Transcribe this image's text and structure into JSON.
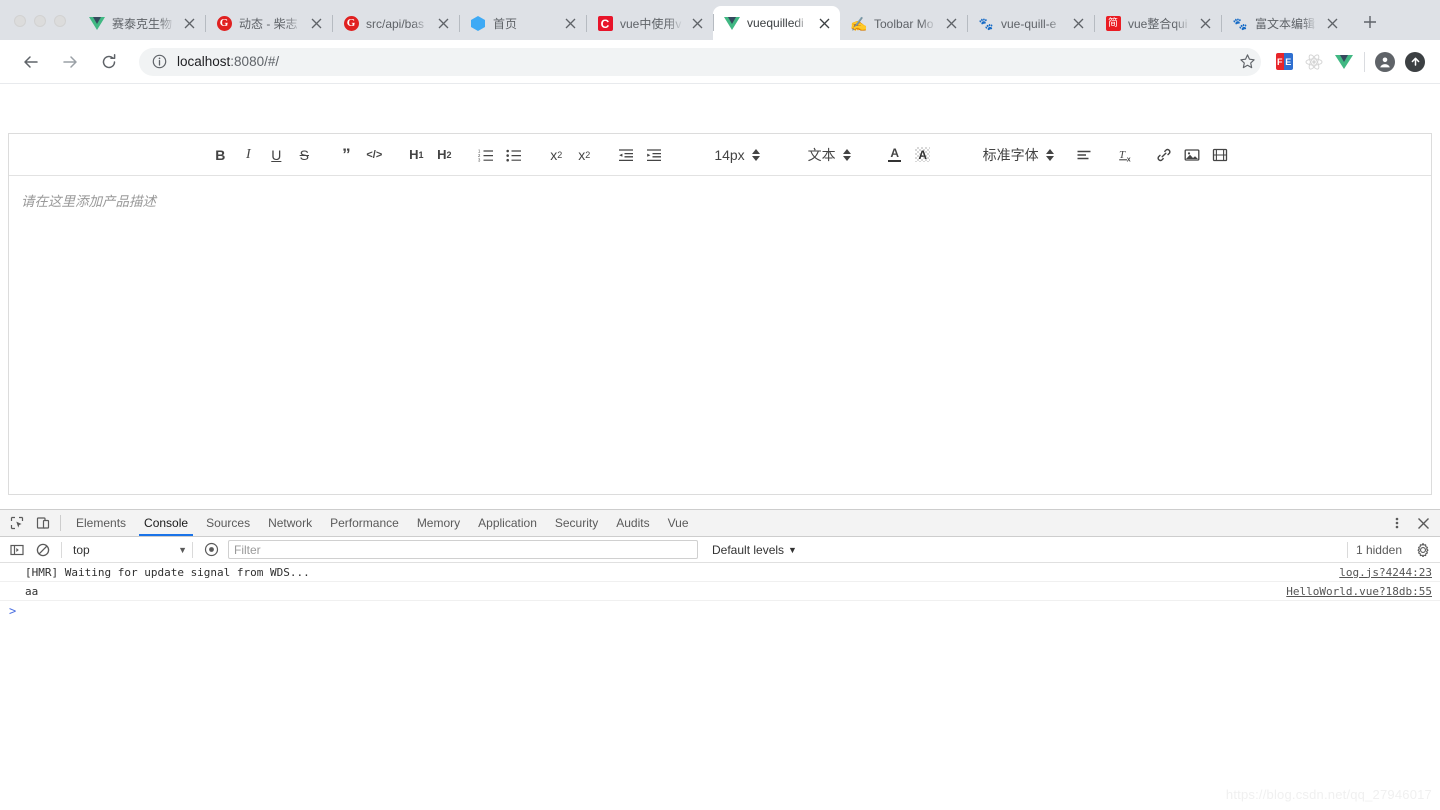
{
  "browser": {
    "window_controls": [
      "close",
      "minimize",
      "maximize"
    ],
    "tabs": [
      {
        "title": "赛泰克生物",
        "icon": "vue-icon",
        "active": false
      },
      {
        "title": "动态 - 柴志",
        "icon": "gitee-icon",
        "active": false
      },
      {
        "title": "src/api/bas",
        "icon": "gitee-icon",
        "active": false
      },
      {
        "title": "首页",
        "icon": "cube-icon",
        "active": false
      },
      {
        "title": "vue中使用v",
        "icon": "csdn-icon",
        "active": false
      },
      {
        "title": "vuequilledi",
        "icon": "vue-icon",
        "active": true
      },
      {
        "title": "Toolbar Mo",
        "icon": "quill-icon",
        "active": false
      },
      {
        "title": "vue-quill-e",
        "icon": "baidu-icon",
        "active": false
      },
      {
        "title": "vue整合qui",
        "icon": "jianshu-icon",
        "active": false
      },
      {
        "title": "富文本编辑",
        "icon": "baidu-icon",
        "active": false
      }
    ],
    "new_tab_label": "+",
    "nav": {
      "back": "back-arrow",
      "forward": "forward-arrow",
      "reload": "reload-icon"
    },
    "omnibox": {
      "info_icon": "info-circle-icon",
      "url_host": "localhost",
      "url_path": ":8080/#/",
      "bookmark_icon": "star-icon"
    },
    "extensions": [
      {
        "name": "fe-helper-icon",
        "left": "F",
        "right": "E"
      },
      {
        "name": "react-devtools-icon"
      },
      {
        "name": "vue-devtools-icon"
      }
    ],
    "profile_icon": "account-icon",
    "update_icon": "update-arrow-icon"
  },
  "editor": {
    "toolbar": {
      "bold": "B",
      "italic": "I",
      "underline": "U",
      "strike": "S",
      "blockquote": "”",
      "code_block": "</>",
      "header1": "H",
      "header1_sub": "1",
      "header2": "H",
      "header2_sub": "2",
      "list_ordered": "ordered-list-icon",
      "list_bullet": "bullet-list-icon",
      "subscript": "x",
      "subscript_sub": "2",
      "superscript": "x",
      "superscript_sup": "2",
      "outdent": "outdent-icon",
      "indent": "indent-icon",
      "size_label": "14px",
      "header_label": "文本",
      "color_label": "A",
      "background_label": "A",
      "font_label": "标准字体",
      "align": "align-left-icon",
      "clean": "clear-format-icon",
      "link": "link-icon",
      "image": "image-icon",
      "video": "video-icon"
    },
    "placeholder": "请在这里添加产品描述",
    "content": ""
  },
  "devtools": {
    "tabs": [
      {
        "label": "Elements",
        "active": false
      },
      {
        "label": "Console",
        "active": true
      },
      {
        "label": "Sources",
        "active": false
      },
      {
        "label": "Network",
        "active": false
      },
      {
        "label": "Performance",
        "active": false
      },
      {
        "label": "Memory",
        "active": false
      },
      {
        "label": "Application",
        "active": false
      },
      {
        "label": "Security",
        "active": false
      },
      {
        "label": "Audits",
        "active": false
      },
      {
        "label": "Vue",
        "active": false
      }
    ],
    "inspect_icon": "inspect-element-icon",
    "device_icon": "device-toolbar-icon",
    "more_icon": "kebab-menu-icon",
    "close_icon": "close-icon",
    "console": {
      "sidebar_icon": "console-sidebar-icon",
      "clear_icon": "clear-console-icon",
      "context": "top",
      "eye_icon": "live-expression-icon",
      "filter_placeholder": "Filter",
      "filter_value": "",
      "levels_label": "Default levels",
      "hidden_label": "1 hidden",
      "settings_icon": "gear-icon",
      "messages": [
        {
          "text": "[HMR] Waiting for update signal from WDS...",
          "source": "log.js?4244:23"
        },
        {
          "text": "aa",
          "source": "HelloWorld.vue?18db:55"
        }
      ],
      "prompt": ">"
    }
  },
  "watermark": "https://blog.csdn.net/qq_27946017",
  "colors": {
    "accent": "#1a73e8",
    "vue_green": "#41b883",
    "tabstrip": "#dee1e6",
    "omnibox_bg": "#f1f3f4"
  }
}
